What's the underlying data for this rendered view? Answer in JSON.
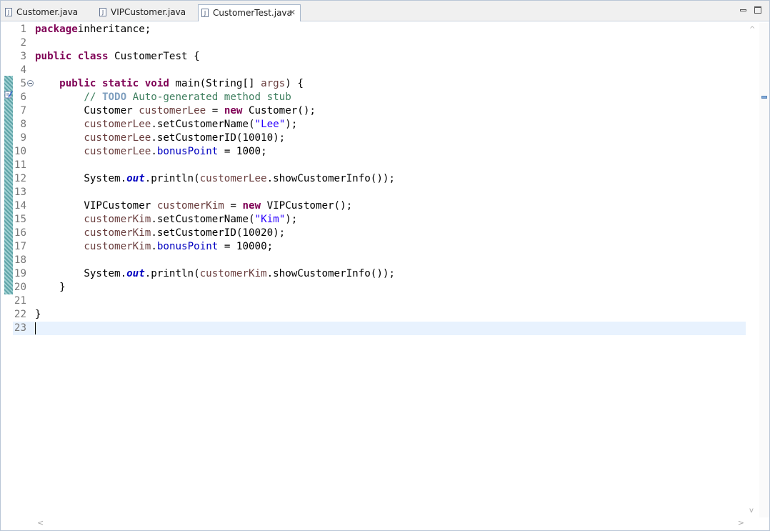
{
  "tabs": [
    {
      "label": "Customer.java",
      "icon": "java-file-icon"
    },
    {
      "label": "VIPCustomer.java",
      "icon": "java-file-icon"
    },
    {
      "label": "CustomerTest.java",
      "icon": "java-file-icon",
      "active": true,
      "close": "✕"
    }
  ],
  "window_controls": {
    "minimize": "minimize-icon",
    "maximize": "maximize-icon"
  },
  "editor": {
    "lines": [
      {
        "num": "1",
        "tokens": [
          [
            "kw",
            "package"
          ],
          [
            "",
            "inheritance;"
          ]
        ]
      },
      {
        "num": "2",
        "tokens": []
      },
      {
        "num": "3",
        "tokens": [
          [
            "kw",
            "public"
          ],
          [
            "",
            " "
          ],
          [
            "kw",
            "class"
          ],
          [
            "",
            " CustomerTest {"
          ]
        ]
      },
      {
        "num": "4",
        "tokens": []
      },
      {
        "num": "5",
        "fold": true,
        "tokens": [
          [
            "",
            "    "
          ],
          [
            "kw",
            "public"
          ],
          [
            "",
            " "
          ],
          [
            "kw",
            "static"
          ],
          [
            "",
            " "
          ],
          [
            "kw",
            "void"
          ],
          [
            "",
            " main(String[] "
          ],
          [
            "var",
            "args"
          ],
          [
            "",
            ") {"
          ]
        ]
      },
      {
        "num": "6",
        "tokens": [
          [
            "",
            "        "
          ],
          [
            "cm",
            "// "
          ],
          [
            "todo",
            "TODO"
          ],
          [
            "cm",
            " Auto-generated method stub"
          ]
        ]
      },
      {
        "num": "7",
        "tokens": [
          [
            "",
            "        Customer "
          ],
          [
            "var",
            "customerLee"
          ],
          [
            "",
            " = "
          ],
          [
            "kw",
            "new"
          ],
          [
            "",
            " Customer();"
          ]
        ]
      },
      {
        "num": "8",
        "tokens": [
          [
            "",
            "        "
          ],
          [
            "var",
            "customerLee"
          ],
          [
            "",
            ".setCustomerName("
          ],
          [
            "str",
            "\"Lee\""
          ],
          [
            "",
            ");"
          ]
        ]
      },
      {
        "num": "9",
        "tokens": [
          [
            "",
            "        "
          ],
          [
            "var",
            "customerLee"
          ],
          [
            "",
            ".setCustomerID(10010);"
          ]
        ]
      },
      {
        "num": "10",
        "tokens": [
          [
            "",
            "        "
          ],
          [
            "var",
            "customerLee"
          ],
          [
            "",
            "."
          ],
          [
            "fld",
            "bonusPoint"
          ],
          [
            "",
            " = 1000;"
          ]
        ]
      },
      {
        "num": "11",
        "tokens": []
      },
      {
        "num": "12",
        "tokens": [
          [
            "",
            "        System."
          ],
          [
            "sfld",
            "out"
          ],
          [
            "",
            ".println("
          ],
          [
            "var",
            "customerLee"
          ],
          [
            "",
            ".showCustomerInfo());"
          ]
        ]
      },
      {
        "num": "13",
        "tokens": []
      },
      {
        "num": "14",
        "tokens": [
          [
            "",
            "        VIPCustomer "
          ],
          [
            "var",
            "customerKim"
          ],
          [
            "",
            " = "
          ],
          [
            "kw",
            "new"
          ],
          [
            "",
            " VIPCustomer();"
          ]
        ]
      },
      {
        "num": "15",
        "tokens": [
          [
            "",
            "        "
          ],
          [
            "var",
            "customerKim"
          ],
          [
            "",
            ".setCustomerName("
          ],
          [
            "str",
            "\"Kim\""
          ],
          [
            "",
            ");"
          ]
        ]
      },
      {
        "num": "16",
        "tokens": [
          [
            "",
            "        "
          ],
          [
            "var",
            "customerKim"
          ],
          [
            "",
            ".setCustomerID(10020);"
          ]
        ]
      },
      {
        "num": "17",
        "tokens": [
          [
            "",
            "        "
          ],
          [
            "var",
            "customerKim"
          ],
          [
            "",
            "."
          ],
          [
            "fld",
            "bonusPoint"
          ],
          [
            "",
            " = 10000;"
          ]
        ]
      },
      {
        "num": "18",
        "tokens": []
      },
      {
        "num": "19",
        "tokens": [
          [
            "",
            "        System."
          ],
          [
            "sfld",
            "out"
          ],
          [
            "",
            ".println("
          ],
          [
            "var",
            "customerKim"
          ],
          [
            "",
            ".showCustomerInfo());"
          ]
        ]
      },
      {
        "num": "20",
        "tokens": [
          [
            "",
            "    }"
          ]
        ]
      },
      {
        "num": "21",
        "tokens": []
      },
      {
        "num": "22",
        "tokens": [
          [
            "",
            "}"
          ]
        ]
      },
      {
        "num": "23",
        "tokens": [],
        "current": true
      }
    ]
  },
  "scroll_arrows": {
    "up": "^",
    "down": "v",
    "left": "<",
    "right": ">"
  },
  "colors": {
    "keyword": "#7f0055",
    "comment": "#3f7f5f",
    "string": "#2a00ff",
    "field": "#0000c0",
    "local_var": "#6a3e3e",
    "current_line": "#e8f2fe"
  }
}
